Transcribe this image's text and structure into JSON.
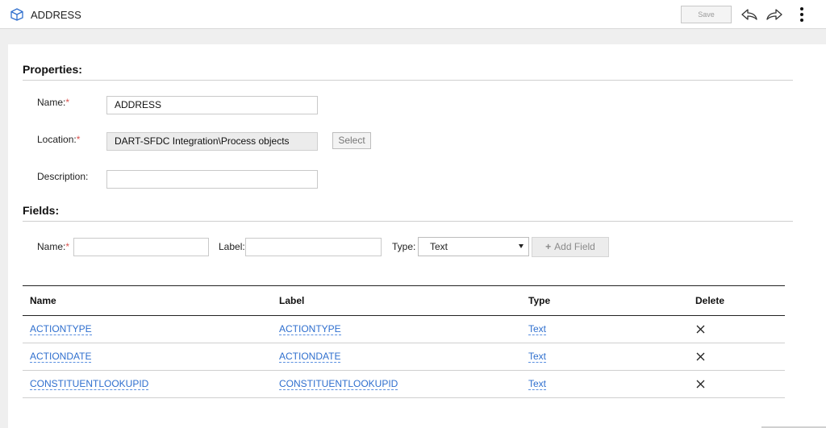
{
  "header": {
    "title": "ADDRESS",
    "icon": "cube-icon",
    "save_label": "Save"
  },
  "properties": {
    "section_title": "Properties:",
    "name_label": "Name:",
    "name_value": "ADDRESS",
    "location_label": "Location:",
    "location_value": "DART-SFDC Integration\\Process objects",
    "select_label": "Select",
    "description_label": "Description:",
    "description_value": ""
  },
  "fields": {
    "section_title": "Fields:",
    "name_label": "Name:",
    "label_label": "Label:",
    "type_label": "Type:",
    "type_selected": "Text",
    "add_label": "Add Field"
  },
  "table": {
    "columns": [
      "Name",
      "Label",
      "Type",
      "Delete"
    ],
    "rows": [
      {
        "name": "ACTIONTYPE",
        "label": "ACTIONTYPE",
        "type": "Text"
      },
      {
        "name": "ACTIONDATE",
        "label": "ACTIONDATE",
        "type": "Text"
      },
      {
        "name": "CONSTITUENTLOOKUPID",
        "label": "CONSTITUENTLOOKUPID",
        "type": "Text"
      }
    ]
  },
  "colors": {
    "link": "#2f6fce",
    "required": "#d9534f",
    "background": "#efefef"
  }
}
